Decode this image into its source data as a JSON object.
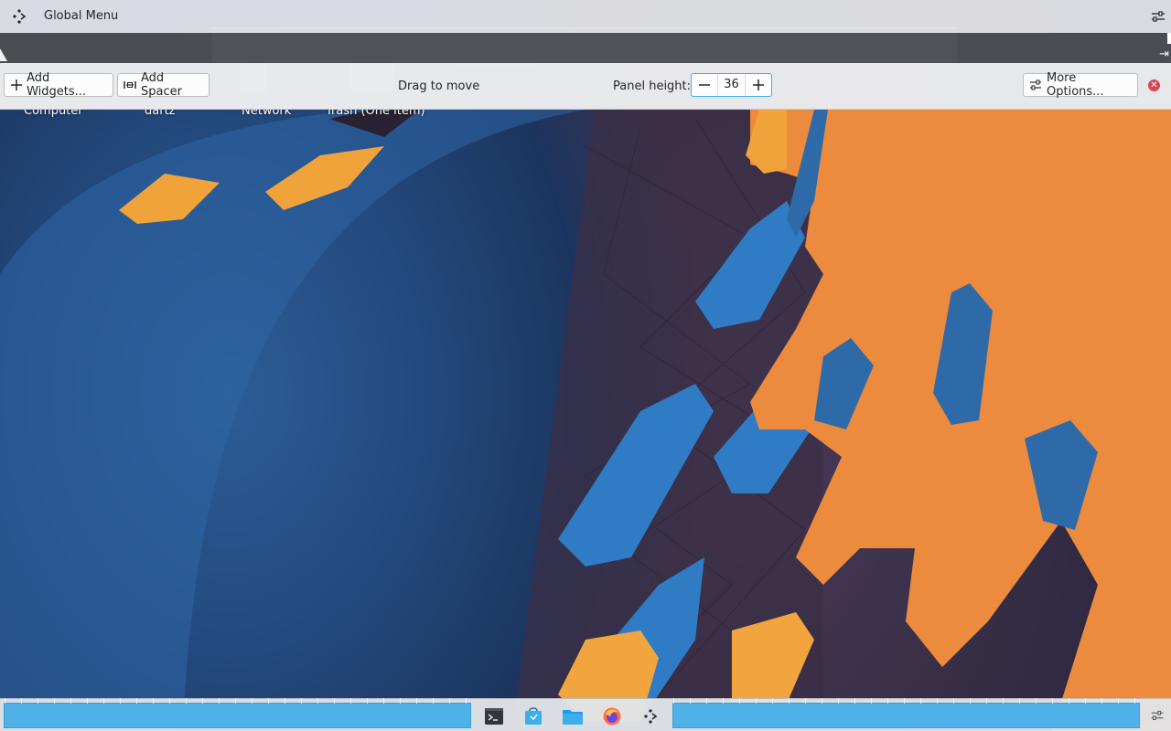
{
  "global_menu": {
    "title": "Global Menu",
    "icon": "kde-menu-icon",
    "config_icon": "panel-config-icon"
  },
  "toolbar": {
    "add_widgets_label": "Add Widgets...",
    "add_spacer_label": "Add Spacer",
    "drag_label": "Drag to move",
    "panel_height_label": "Panel height:",
    "panel_height_value": "36",
    "more_options_label": "More Options..."
  },
  "desktop_icons": [
    {
      "label": "Computer"
    },
    {
      "label": "dartz"
    },
    {
      "label": "Network"
    },
    {
      "label": "Trash (One item)"
    }
  ],
  "task_panel": {
    "launchers": [
      "terminal-icon",
      "discover-store-icon",
      "file-manager-icon",
      "firefox-icon",
      "application-launcher-icon"
    ]
  },
  "colors": {
    "accent": "#3daee9",
    "spacer_fill": "#4fb1e8",
    "close_red": "#da4453",
    "wallpaper_orange": "#e8843c",
    "wallpaper_blue": "#2f6fae"
  }
}
